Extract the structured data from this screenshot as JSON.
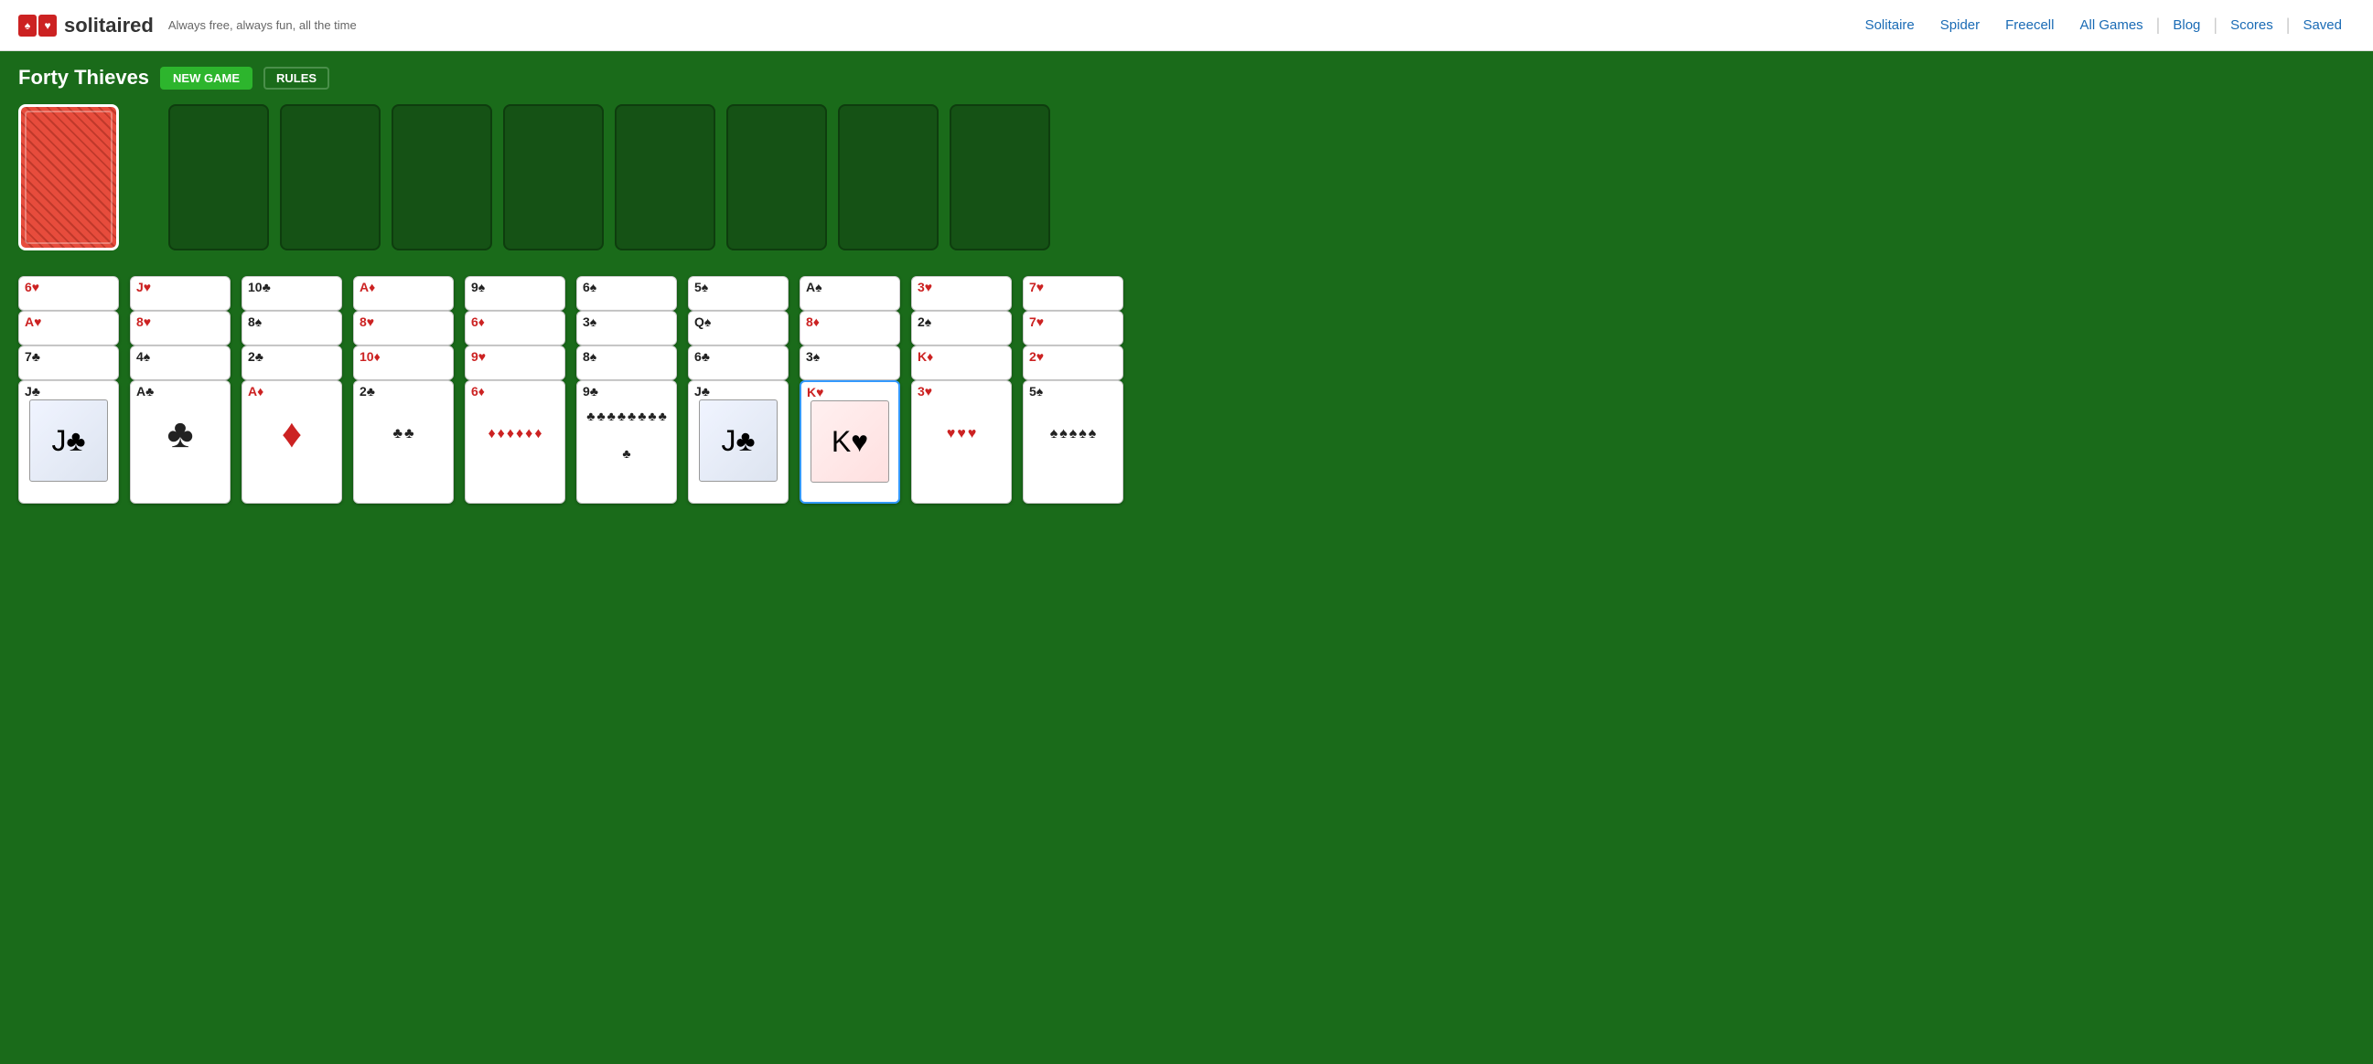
{
  "header": {
    "logo_text": "solitaired",
    "tagline": "Always free, always fun, all the time",
    "nav": [
      {
        "label": "Solitaire",
        "href": "#"
      },
      {
        "label": "Spider",
        "href": "#"
      },
      {
        "label": "Freecell",
        "href": "#"
      },
      {
        "label": "All Games",
        "href": "#"
      },
      {
        "label": "Blog",
        "href": "#"
      },
      {
        "label": "Scores",
        "href": "#"
      },
      {
        "label": "Saved",
        "href": "#"
      }
    ]
  },
  "game": {
    "title": "Forty Thieves",
    "new_game_label": "NEW GAME",
    "rules_label": "RULES"
  },
  "tableau_columns": [
    {
      "cards": [
        {
          "rank": "6",
          "suit": "♥",
          "color": "red",
          "label": "6♥"
        },
        {
          "rank": "A",
          "suit": "♥",
          "color": "red",
          "label": "A♥"
        },
        {
          "rank": "7",
          "suit": "♣",
          "color": "black",
          "label": "7♣"
        },
        {
          "rank": "J",
          "suit": "♣",
          "color": "black",
          "label": "J♣",
          "face": true
        }
      ]
    },
    {
      "cards": [
        {
          "rank": "J",
          "suit": "♥",
          "color": "red",
          "label": "J♥",
          "face": true
        },
        {
          "rank": "8",
          "suit": "♥",
          "color": "red",
          "label": "8♥"
        },
        {
          "rank": "4",
          "suit": "♠",
          "color": "black",
          "label": "4♠"
        },
        {
          "rank": "A",
          "suit": "♣",
          "color": "black",
          "label": "A♣",
          "face": false
        }
      ]
    },
    {
      "cards": [
        {
          "rank": "10",
          "suit": "♣",
          "color": "black",
          "label": "10♣"
        },
        {
          "rank": "8",
          "suit": "♠",
          "color": "black",
          "label": "8♠"
        },
        {
          "rank": "2",
          "suit": "♣",
          "color": "black",
          "label": "2♣"
        },
        {
          "rank": "A",
          "suit": "♦",
          "color": "red",
          "label": "A♦"
        }
      ]
    },
    {
      "cards": [
        {
          "rank": "A",
          "suit": "♦",
          "color": "red",
          "label": "A♦"
        },
        {
          "rank": "8",
          "suit": "♥",
          "color": "red",
          "label": "8♥"
        },
        {
          "rank": "10",
          "suit": "♦",
          "color": "red",
          "label": "10♦"
        },
        {
          "rank": "2",
          "suit": "♣",
          "color": "black",
          "label": "2♣"
        }
      ]
    },
    {
      "cards": [
        {
          "rank": "9",
          "suit": "♠",
          "color": "black",
          "label": "9♠"
        },
        {
          "rank": "6",
          "suit": "♦",
          "color": "red",
          "label": "6♦"
        },
        {
          "rank": "9",
          "suit": "♥",
          "color": "red",
          "label": "9♥"
        },
        {
          "rank": "6",
          "suit": "♦",
          "color": "red",
          "label": "6♦"
        }
      ]
    },
    {
      "cards": [
        {
          "rank": "6",
          "suit": "♠",
          "color": "black",
          "label": "6♠"
        },
        {
          "rank": "3",
          "suit": "♠",
          "color": "black",
          "label": "3♠"
        },
        {
          "rank": "8",
          "suit": "♠",
          "color": "black",
          "label": "8♠"
        },
        {
          "rank": "9",
          "suit": "♣",
          "color": "black",
          "label": "9♣"
        }
      ]
    },
    {
      "cards": [
        {
          "rank": "5",
          "suit": "♠",
          "color": "black",
          "label": "5♠"
        },
        {
          "rank": "Q",
          "suit": "♠",
          "color": "black",
          "label": "Q♠",
          "face": true
        },
        {
          "rank": "6",
          "suit": "♣",
          "color": "black",
          "label": "6♣"
        },
        {
          "rank": "J",
          "suit": "♣",
          "color": "black",
          "label": "J♣",
          "face": true
        }
      ]
    },
    {
      "cards": [
        {
          "rank": "A",
          "suit": "♠",
          "color": "black",
          "label": "A♠"
        },
        {
          "rank": "8",
          "suit": "♦",
          "color": "red",
          "label": "8♦"
        },
        {
          "rank": "3",
          "suit": "♠",
          "color": "black",
          "label": "3♠"
        },
        {
          "rank": "K",
          "suit": "♥",
          "color": "red",
          "label": "K♥",
          "face": true,
          "selected": true
        }
      ]
    },
    {
      "cards": [
        {
          "rank": "3",
          "suit": "♥",
          "color": "red",
          "label": "3♥"
        },
        {
          "rank": "2",
          "suit": "♠",
          "color": "black",
          "label": "2♠"
        },
        {
          "rank": "K",
          "suit": "♦",
          "color": "red",
          "label": "K♦",
          "face": true
        },
        {
          "rank": "3",
          "suit": "♥",
          "color": "red",
          "label": "3♥"
        }
      ]
    },
    {
      "cards": [
        {
          "rank": "7",
          "suit": "♥",
          "color": "red",
          "label": "7♥"
        },
        {
          "rank": "7",
          "suit": "♥",
          "color": "red",
          "label": "7♥"
        },
        {
          "rank": "2",
          "suit": "♥",
          "color": "red",
          "label": "2♥"
        },
        {
          "rank": "5",
          "suit": "♠",
          "color": "black",
          "label": "5♠"
        }
      ]
    }
  ]
}
